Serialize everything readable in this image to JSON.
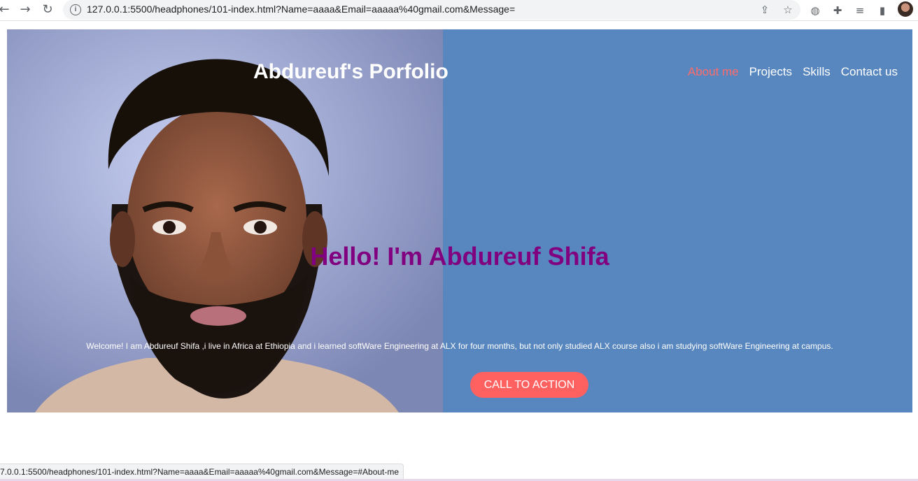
{
  "browser": {
    "url": "127.0.0.1:5500/headphones/101-index.html?Name=aaaa&Email=aaaaa%40gmail.com&Message=",
    "icons": [
      "back-icon",
      "forward-icon",
      "reload-icon",
      "info-icon",
      "share-icon",
      "star-icon",
      "globe-icon",
      "extensions-icon",
      "media-icon",
      "side-panel-icon",
      "profile-avatar"
    ]
  },
  "site": {
    "title": "Abdureuf's Porfolio",
    "nav": [
      {
        "label": "About me",
        "active": true
      },
      {
        "label": "Projects",
        "active": false
      },
      {
        "label": "Skills",
        "active": false
      },
      {
        "label": "Contact us",
        "active": false
      }
    ],
    "hero_heading": "Hello! I'm Abdureuf Shifa",
    "welcome_text": "Welcome! I am Abdureuf Shifa ,i live in Africa at Ethiopia and i learned softWare Engineering at ALX for four months, but not only studied ALX course also i am studying softWare Engineering at campus.",
    "cta_label": "CALL TO ACTION"
  },
  "status_bar": {
    "text": "7.0.0.1:5500/headphones/101-index.html?Name=aaaa&Email=aaaaa%40gmail.com&Message=#About-me"
  },
  "colors": {
    "hero_bg": "#5887bf",
    "nav_active": "#ff6b6b",
    "heading": "#800080",
    "cta_bg": "#ff6161"
  }
}
